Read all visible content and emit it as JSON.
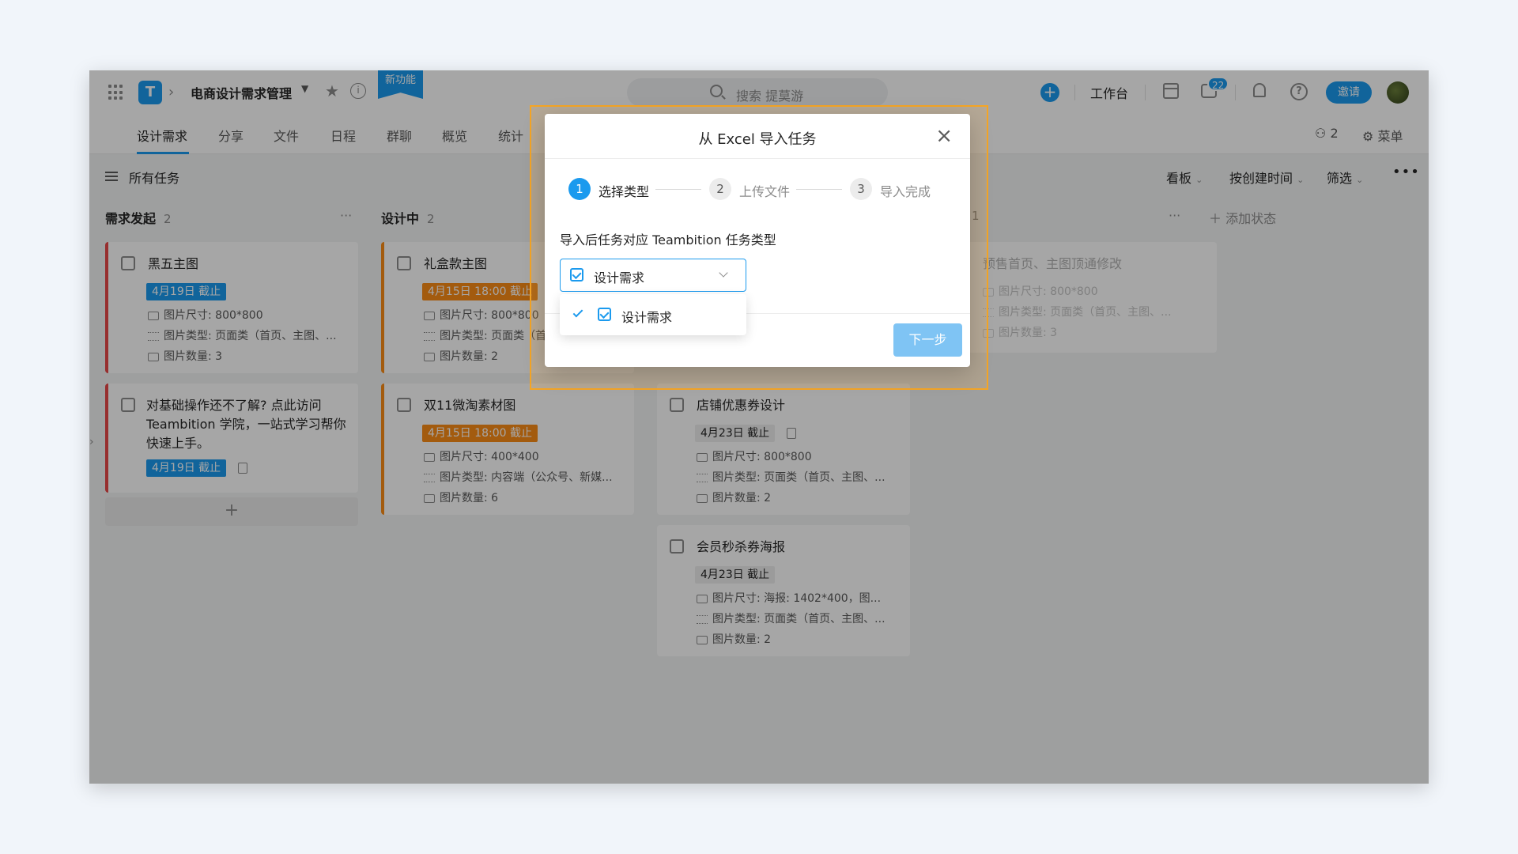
{
  "header": {
    "project_name": "电商设计需求管理",
    "new_feature": "新功能",
    "search_placeholder": "搜索 提莫游",
    "workbench": "工作台",
    "message_count": "22",
    "invite": "邀请"
  },
  "nav": {
    "tabs": [
      "设计需求",
      "分享",
      "文件",
      "日程",
      "群聊",
      "概览",
      "统计"
    ],
    "members": "2",
    "menu": "菜单"
  },
  "toolbar": {
    "all_tasks": "所有任务",
    "view": "看板",
    "sort": "按创建时间",
    "filter": "筛选"
  },
  "columns": [
    {
      "title": "需求发起",
      "count": "2"
    },
    {
      "title": "设计中",
      "count": "2"
    },
    {
      "title": "",
      "count": "1"
    }
  ],
  "add_status": "添加状态",
  "cards": {
    "c1": {
      "title": "黑五主图",
      "date": "4月19日 截止",
      "size": "图片尺寸: 800*800",
      "type": "图片类型: 页面类（首页、主图、...",
      "count": "图片数量: 3"
    },
    "c2": {
      "title": "对基础操作还不了解? 点此访问 Teambition 学院，一站式学习帮你快速上手。",
      "date": "4月19日 截止"
    },
    "c3": {
      "title": "礼盒款主图",
      "date": "4月15日 18:00 截止",
      "size": "图片尺寸: 800*800",
      "type": "图片类型: 页面类（首",
      "count": "图片数量: 2"
    },
    "c4": {
      "title": "双11微淘素材图",
      "date": "4月15日 18:00 截止",
      "size": "图片尺寸: 400*400",
      "type": "图片类型: 内容端（公众号、新媒...",
      "count": "图片数量: 6"
    },
    "c5": {
      "title": "店铺优惠券设计",
      "date": "4月23日 截止",
      "size": "图片尺寸: 800*800",
      "type": "图片类型: 页面类（首页、主图、...",
      "count": "图片数量: 2"
    },
    "c6": {
      "title": "会员秒杀券海报",
      "date": "4月23日 截止",
      "size": "图片尺寸: 海报: 1402*400，图...",
      "type": "图片类型: 页面类（首页、主图、...",
      "count": "图片数量: 2"
    },
    "c7": {
      "title": "预售首页、主图顶通修改",
      "size": "图片尺寸: 800*800",
      "type": "图片类型: 页面类（首页、主图、...",
      "count": "图片数量: 3"
    }
  },
  "modal": {
    "title": "从 Excel 导入任务",
    "steps": [
      {
        "num": "1",
        "label": "选择类型"
      },
      {
        "num": "2",
        "label": "上传文件"
      },
      {
        "num": "3",
        "label": "导入完成"
      }
    ],
    "field_label": "导入后任务对应 Teambition 任务类型",
    "selected": "设计需求",
    "option": "设计需求",
    "next": "下一步"
  },
  "colors": {
    "accent": "#1b9aee",
    "red": "#e94848",
    "orange": "#fa8c16",
    "highlight": "#f5a524"
  }
}
